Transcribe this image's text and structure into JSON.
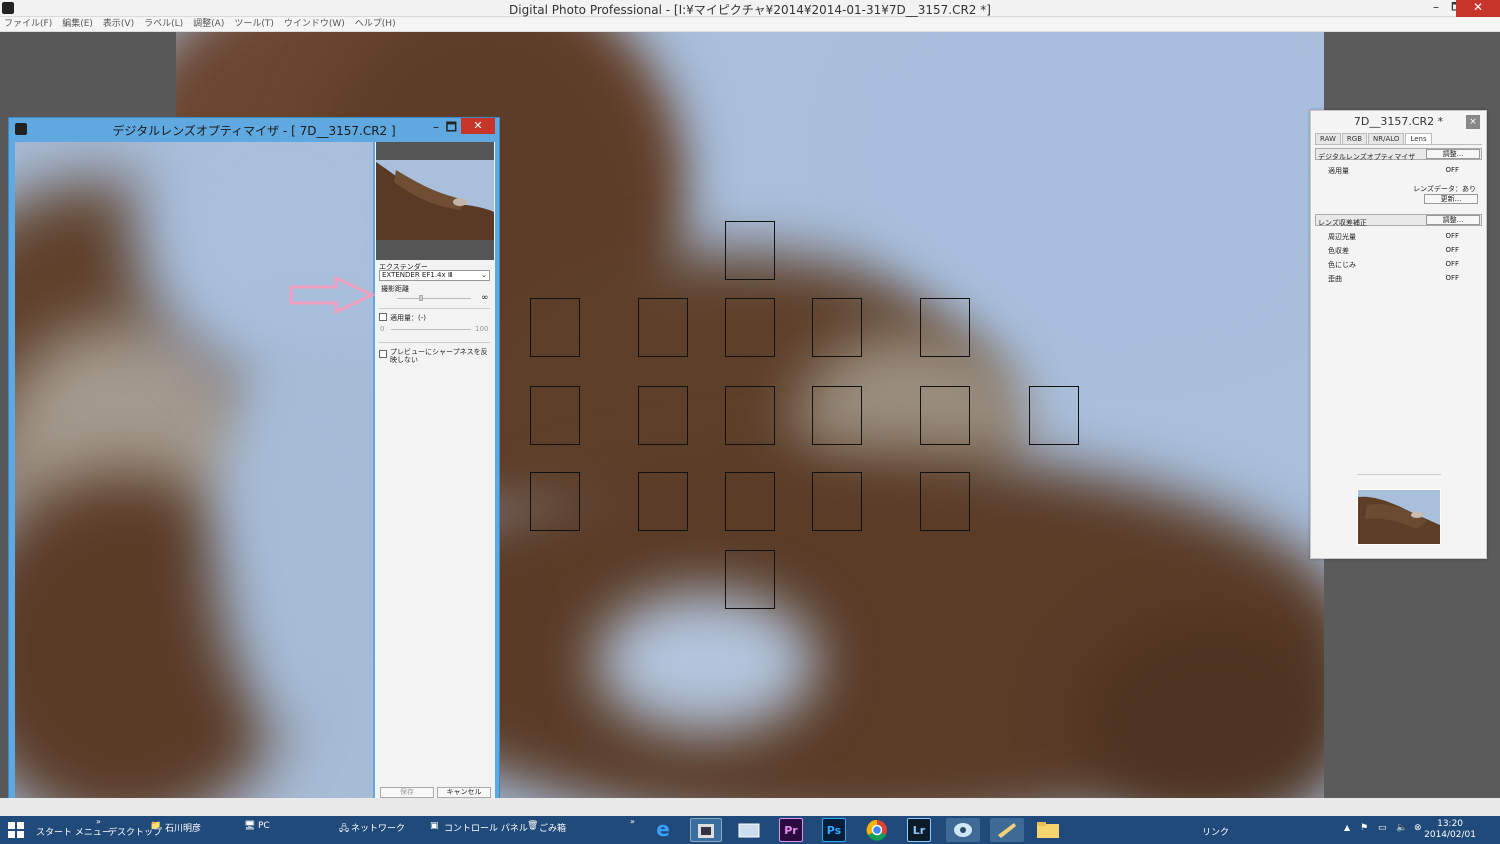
{
  "window": {
    "title": "Digital Photo Professional - [I:¥マイピクチャ¥2014¥2014-01-31¥7D__3157.CR2 *]",
    "minimize": "–",
    "maximize": "🗖",
    "close": "✕"
  },
  "menu": [
    "ファイル(F)",
    "編集(E)",
    "表示(V)",
    "ラベル(L)",
    "調整(A)",
    "ツール(T)",
    "ウインドウ(W)",
    "ヘルプ(H)"
  ],
  "dialog": {
    "title": "デジタルレンズオプティマイザ - [ 7D__3157.CR2 ]",
    "minimize": "–",
    "maximize": "🗖",
    "close": "✕",
    "extender_label": "エクステンダー",
    "extender_value": "EXTENDER EF1.4x Ⅲ",
    "distance_label": "撮影距離",
    "distance_max": "∞",
    "amount_label": "適用量：(-)",
    "amount_min": "0",
    "amount_max": "100",
    "preview_label": "プレビューにシャープネスを反映しない",
    "save": "保存",
    "cancel": "キャンセル"
  },
  "palette": {
    "title": "7D__3157.CR2 *",
    "close": "×",
    "tabs": [
      "RAW",
      "RGB",
      "NR/ALO",
      "Lens"
    ],
    "dlo_section": "デジタルレンズオプティマイザ",
    "adjust_btn": "調整...",
    "amount_key": "適用量",
    "amount_val": "OFF",
    "lens_data": "レンズデータ：あり",
    "update_btn": "更新...",
    "aberration_section": "レンズ収差補正",
    "adjust_btn2": "調整...",
    "rows": [
      {
        "k": "周辺光量",
        "v": "OFF"
      },
      {
        "k": "色収差",
        "v": "OFF"
      },
      {
        "k": "色にじみ",
        "v": "OFF"
      },
      {
        "k": "歪曲",
        "v": "OFF"
      }
    ]
  },
  "taskbar": {
    "start": "スタート メニュー",
    "desktop": "デスクトップ",
    "user": "石川明彦",
    "pc": "PC",
    "network": "ネットワーク",
    "control_panel": "コントロール パネル",
    "trash": "ごみ箱",
    "link": "リンク",
    "time": "13:20",
    "date": "2014/02/01",
    "apps": [
      "Pr",
      "Ps",
      "Lr"
    ]
  },
  "colors": {
    "taskbar": "#1f4a7a",
    "dialog_frame": "#5fa8e0",
    "close_red": "#c7352a",
    "sky": "#a9bfdc",
    "feather": "#5a3a24"
  }
}
